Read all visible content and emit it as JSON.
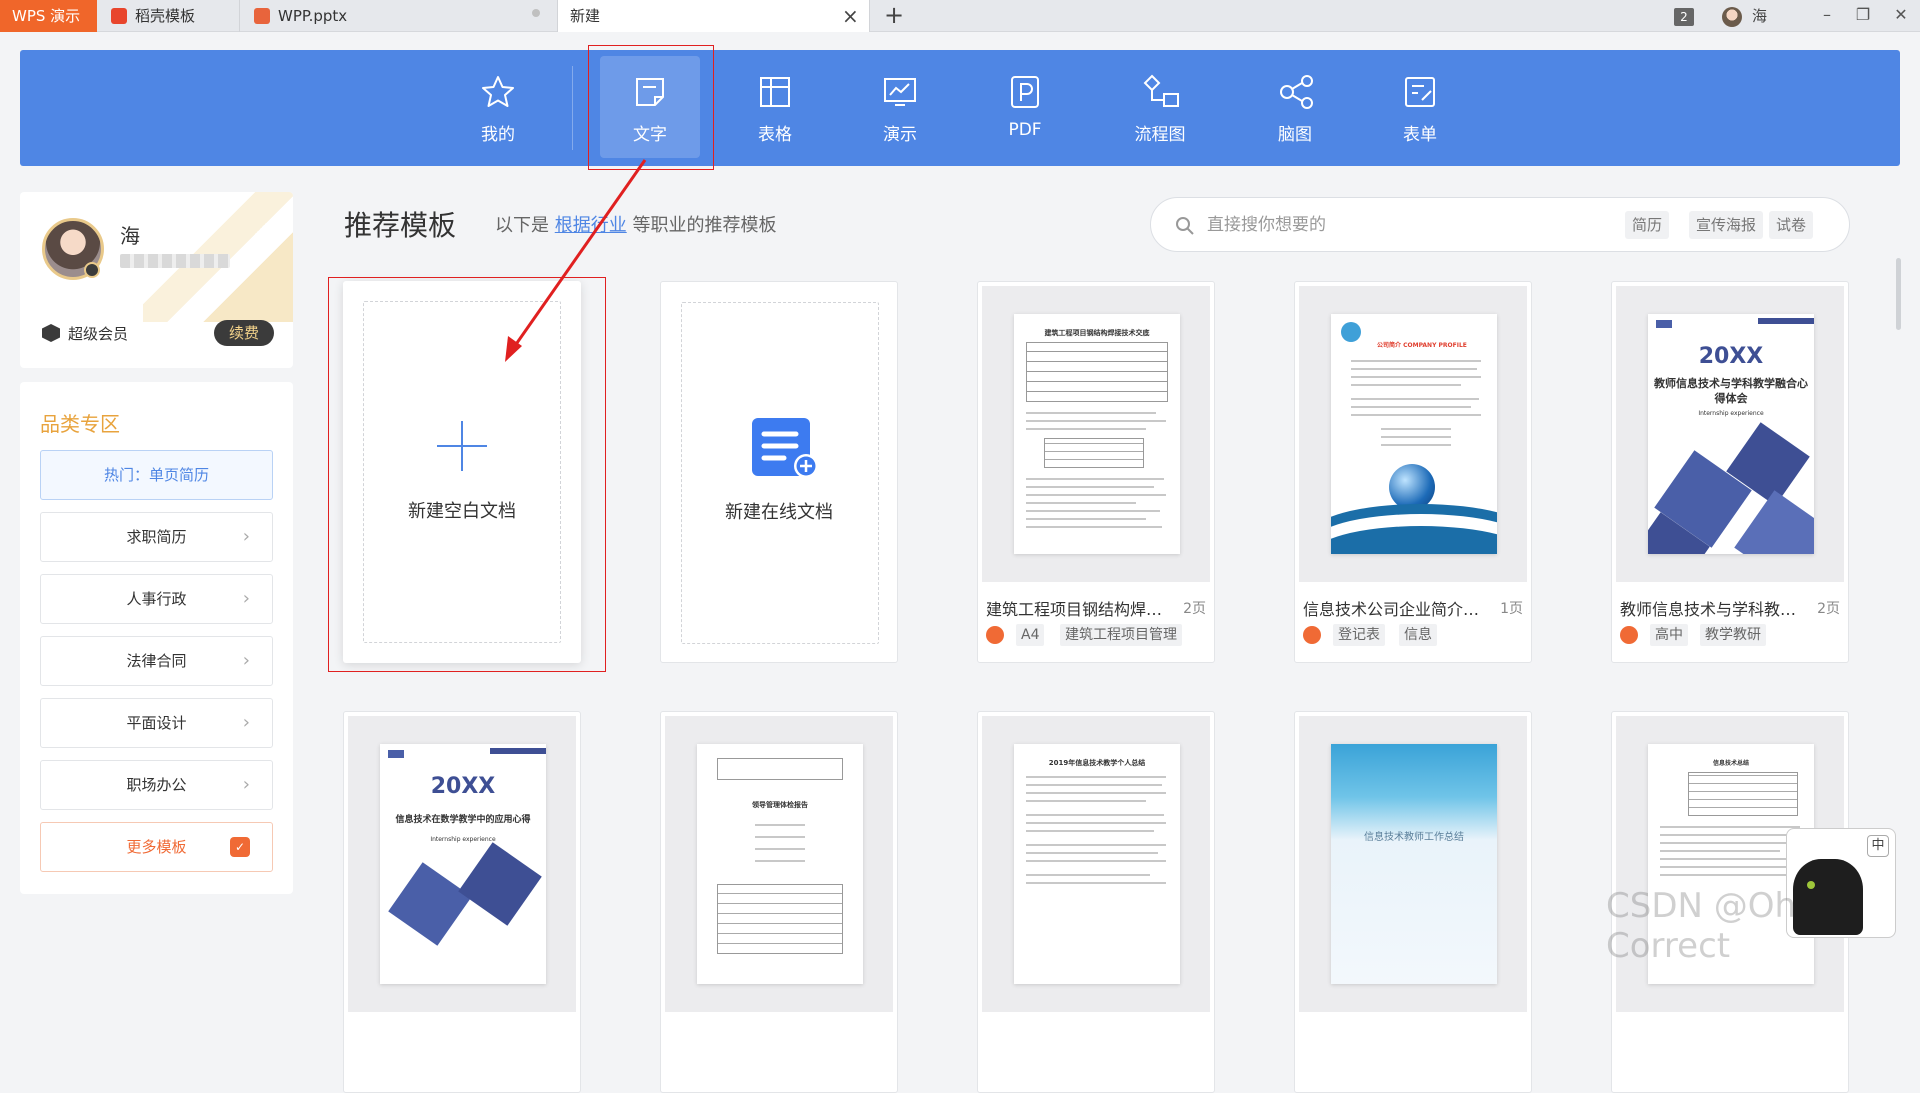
{
  "titlebar": {
    "app_label": "WPS 演示",
    "tabs": [
      {
        "label": "稻壳模板"
      },
      {
        "label": "WPP.pptx"
      },
      {
        "label": "新建"
      }
    ],
    "window_count": "2",
    "user_name": "海"
  },
  "categories": [
    {
      "label": "我的",
      "icon": "star-icon"
    },
    {
      "label": "文字",
      "icon": "document-icon"
    },
    {
      "label": "表格",
      "icon": "table-icon"
    },
    {
      "label": "演示",
      "icon": "presentation-icon"
    },
    {
      "label": "PDF",
      "icon": "pdf-icon"
    },
    {
      "label": "流程图",
      "icon": "flowchart-icon"
    },
    {
      "label": "脑图",
      "icon": "mindmap-icon"
    },
    {
      "label": "表单",
      "icon": "form-icon"
    }
  ],
  "user": {
    "name": "海",
    "vip_label": "超级会员",
    "renew_label": "续费"
  },
  "sidebar": {
    "title": "品类专区",
    "hot": "热门：单页简历",
    "items": [
      "求职简历",
      "人事行政",
      "法律合同",
      "平面设计",
      "职场办公"
    ],
    "more": "更多模板"
  },
  "main": {
    "title": "推荐模板",
    "subtitle_prefix": "以下是",
    "subtitle_link": "根据行业",
    "subtitle_suffix": "等职业的推荐模板",
    "search_placeholder": "直接搜你想要的",
    "chips": [
      "简历",
      "宣传海报",
      "试卷"
    ]
  },
  "cards": {
    "blank": "新建空白文档",
    "online": "新建在线文档",
    "templates": [
      {
        "title": "建筑工程项目钢结构焊接技术交底",
        "pages": "2页",
        "tags": [
          "A4",
          "建筑工程项目管理"
        ],
        "doc_heading": "建筑工程项目钢结构焊接技术交底"
      },
      {
        "title": "信息技术公司企业简介登记表",
        "pages": "1页",
        "tags": [
          "登记表",
          "信息"
        ],
        "doc_heading": "公司简介 COMPANY PROFILE"
      },
      {
        "title": "教师信息技术与学科教学融合心得体会",
        "pages": "2页",
        "tags": [
          "高中",
          "教学教研"
        ],
        "doc_heading": "20XX",
        "doc_sub": "教师信息技术与学科教学融合心得体会",
        "doc_en": "Internship experience"
      }
    ],
    "row2": [
      {
        "doc_heading": "20XX",
        "doc_sub": "信息技术在数学教学中的应用心得",
        "doc_en": "Internship experience"
      },
      {
        "doc_heading": "领导管理体检报告"
      },
      {
        "doc_heading": "2019年信息技术教学个人总结"
      },
      {
        "doc_heading": "信息技术教师工作总结"
      },
      {
        "doc_heading": "信息技术总结"
      }
    ]
  },
  "watermark": "CSDN @Oh Correct",
  "colors": {
    "accent": "#4f86e4",
    "brand_orange": "#f0662a",
    "annotation_red": "#e02020"
  }
}
